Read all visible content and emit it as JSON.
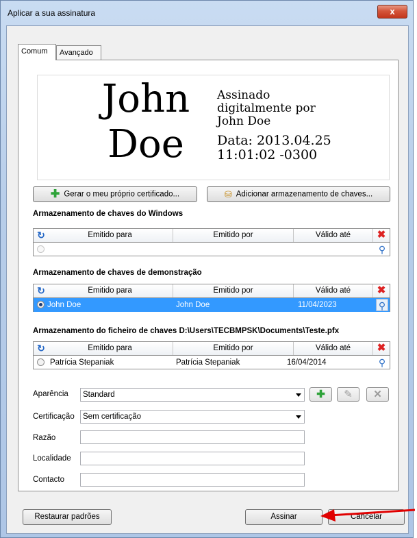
{
  "window": {
    "title": "Aplicar a sua assinatura",
    "close_glyph": "x"
  },
  "tabs": [
    {
      "label": "Comum",
      "active": true
    },
    {
      "label": "Avançado",
      "active": false
    }
  ],
  "preview": {
    "name_line1": "John",
    "name_line2": "Doe",
    "text_line1": "Assinado",
    "text_line2": "digitalmente por",
    "text_line3": "John Doe",
    "date_line1": "Data: 2013.04.25",
    "date_line2": "11:01:02 -0300"
  },
  "actions": {
    "generate_label": "Gerar o meu próprio certificado...",
    "add_store_label": "Adicionar armazenamento de chaves..."
  },
  "columns": {
    "issued_to": "Emitido para",
    "issued_by": "Emitido por",
    "valid_until": "Válido até"
  },
  "stores": [
    {
      "title": "Armazenamento de chaves do Windows",
      "rows": []
    },
    {
      "title": "Armazenamento de chaves de demonstração",
      "rows": [
        {
          "issued_to": "John Doe",
          "issued_by": "John Doe",
          "valid_until": "11/04/2023",
          "selected": true
        }
      ]
    },
    {
      "title": "Armazenamento do ficheiro de chaves D:\\Users\\TECBMPSK\\Documents\\Teste.pfx",
      "rows": [
        {
          "issued_to": "Patrícia Stepaniak",
          "issued_by": "Patrícia Stepaniak",
          "valid_until": "16/04/2014",
          "selected": false
        }
      ]
    }
  ],
  "form": {
    "appearance_label": "Aparência",
    "appearance_value": "Standard",
    "certification_label": "Certificação",
    "certification_value": "Sem certificação",
    "reason_label": "Razão",
    "reason_value": "",
    "location_label": "Localidade",
    "location_value": "",
    "contact_label": "Contacto",
    "contact_value": ""
  },
  "footer": {
    "restore_label": "Restaurar padrões",
    "sign_label": "Assinar",
    "cancel_label": "Cancelar"
  },
  "colors": {
    "selection": "#3399ff",
    "arrow": "#e00000",
    "plus_green": "#2fa33a"
  }
}
